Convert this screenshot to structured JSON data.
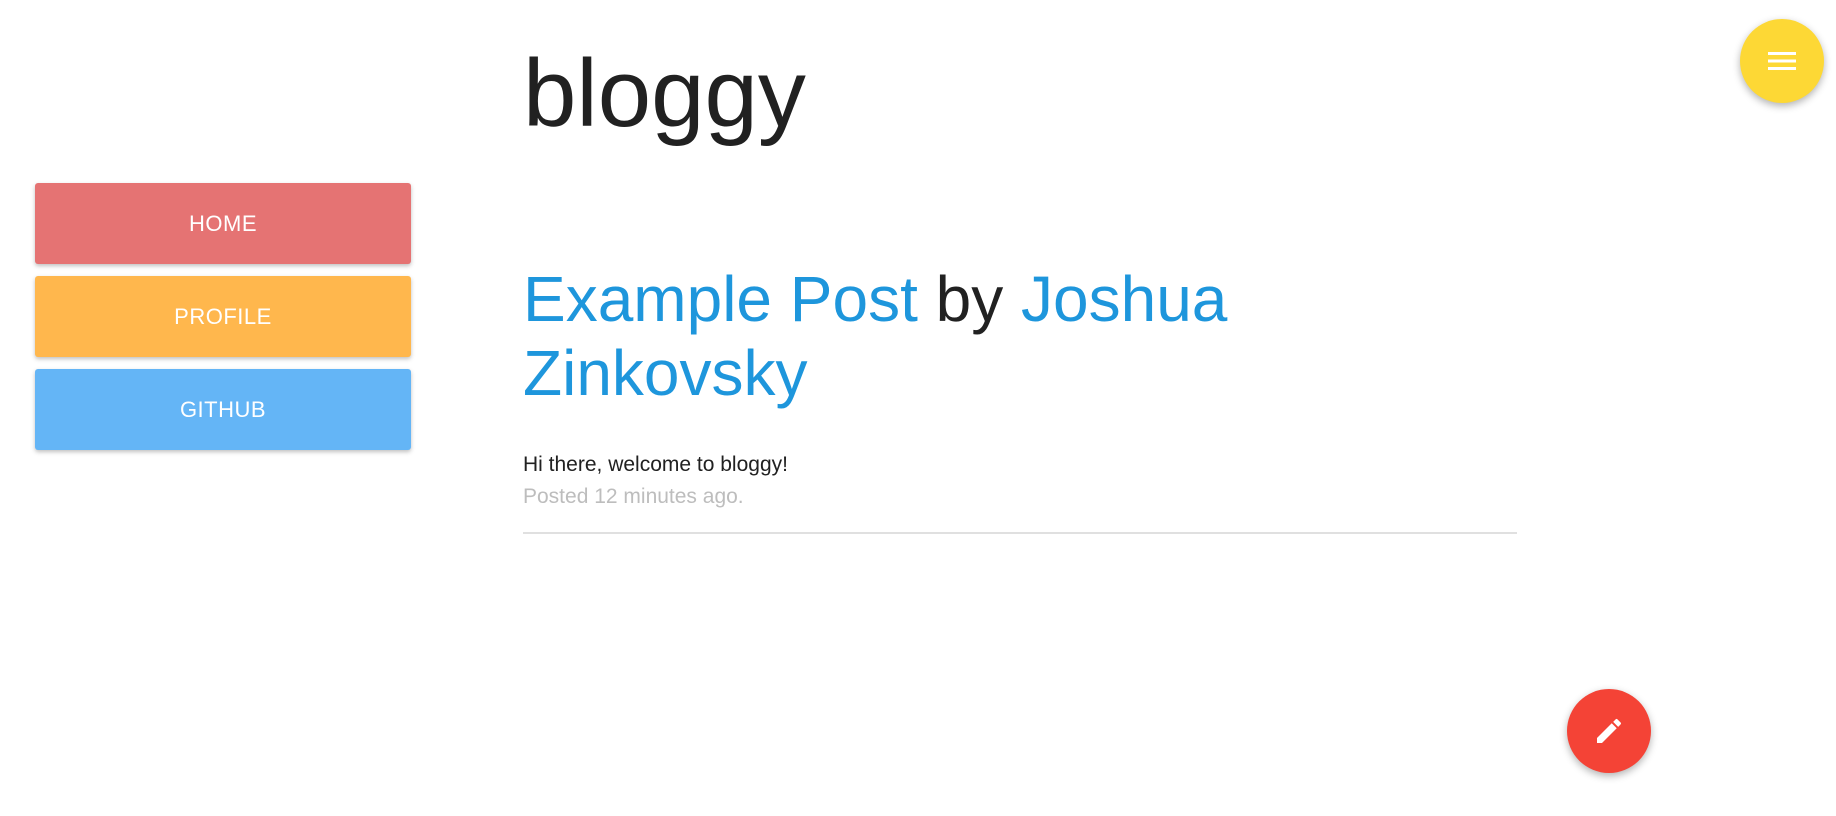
{
  "site": {
    "title": "bloggy"
  },
  "colors": {
    "home": "#e57373",
    "profile": "#ffb74d",
    "github": "#64b5f6",
    "link": "#1e96dc",
    "menu_fab": "#fdd835",
    "edit_fab": "#f44336"
  },
  "sidebar": {
    "items": [
      {
        "label": "HOME"
      },
      {
        "label": "PROFILE"
      },
      {
        "label": "GITHUB"
      }
    ]
  },
  "post": {
    "title": "Example Post",
    "by": "by",
    "author": "Joshua Zinkovsky",
    "body": "Hi there, welcome to bloggy!",
    "meta": "Posted 12 minutes ago."
  },
  "icons": {
    "menu": "hamburger-menu-icon",
    "edit": "pencil-icon"
  }
}
